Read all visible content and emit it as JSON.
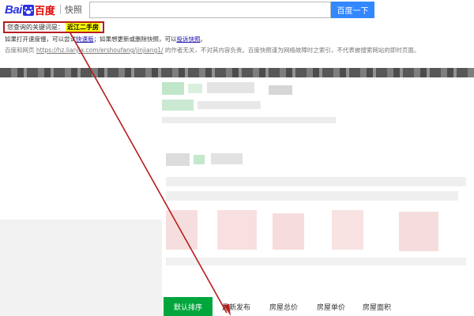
{
  "header": {
    "logo_bai": "Bai",
    "logo_cn": "百度",
    "logo_sub": "快照",
    "search_placeholder": "",
    "search_button": "百度一下"
  },
  "keyword": {
    "label": "您查询的关键词是：",
    "value": "近江二手房"
  },
  "notice": {
    "part1": "如果打开速度慢，可以尝试",
    "link1": "快速版",
    "part2": "；如果想更新或删除快照，可以",
    "link2": "投诉快照",
    "part3": "。"
  },
  "disclaimer": {
    "part1": "百度和网页",
    "url": "https://hz.lianjia.com/ershoufang/jinjiang1/",
    "part2": "的作者无关，不对其内容负责。百度快照谨为网络故障时之索引，不代表被搜索网站的即时页面。"
  },
  "sort_tabs": [
    {
      "label": "默认排序",
      "active": true
    },
    {
      "label": "最新发布",
      "active": false
    },
    {
      "label": "房屋总价",
      "active": false
    },
    {
      "label": "房屋单价",
      "active": false
    },
    {
      "label": "房屋面积",
      "active": false
    }
  ],
  "colors": {
    "accent_green": "#00a63c",
    "search_blue": "#3388ff",
    "highlight_yellow": "#ffff00",
    "annotation_red": "#b71c1c"
  }
}
